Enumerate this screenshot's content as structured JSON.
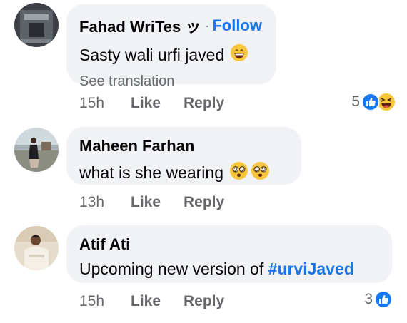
{
  "comments": [
    {
      "author": "Fahad WriTes ッ",
      "follow_label": "Follow",
      "separator": "·",
      "text": "Sasty wali urfi javed",
      "emoji": "grinning-face",
      "see_translation": "See translation",
      "time": "15h",
      "like_label": "Like",
      "reply_label": "Reply",
      "reaction_count": "5",
      "reactions": [
        "like",
        "haha"
      ]
    },
    {
      "author": "Maheen Farhan",
      "text": "what is she wearing",
      "emoji": "face-with-spiral-eyes x2",
      "time": "13h",
      "like_label": "Like",
      "reply_label": "Reply"
    },
    {
      "author": "Atif Ati",
      "text_prefix": "Upcoming new version of ",
      "hashtag": "#urviJaved",
      "time": "15h",
      "like_label": "Like",
      "reply_label": "Reply",
      "reaction_count": "3",
      "reactions": [
        "like"
      ]
    }
  ],
  "colors": {
    "bubble": "#f0f2f5",
    "link_blue": "#1877f2",
    "meta_gray": "#65676b"
  }
}
